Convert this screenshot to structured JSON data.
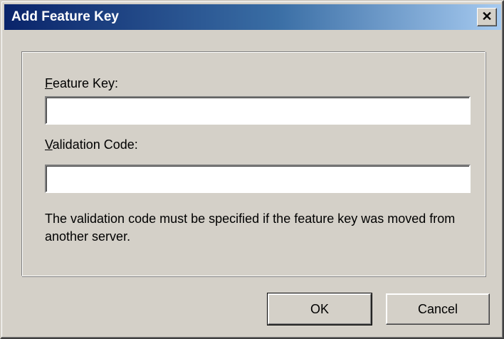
{
  "window": {
    "title": "Add Feature Key",
    "close_glyph": "✕"
  },
  "form": {
    "feature_key_label_mnemonic": "F",
    "feature_key_label_rest": "eature Key:",
    "feature_key_value": "",
    "validation_code_label_mnemonic": "V",
    "validation_code_label_rest": "alidation Code:",
    "validation_code_value": "",
    "note": "The validation code must be specified if the feature key was moved from another server."
  },
  "buttons": {
    "ok_label": "OK",
    "cancel_label": "Cancel"
  },
  "colors": {
    "dialog_face": "#d4d0c8",
    "title_gradient_start": "#0a246a",
    "title_gradient_end": "#a6caf0",
    "title_text": "#ffffff"
  }
}
